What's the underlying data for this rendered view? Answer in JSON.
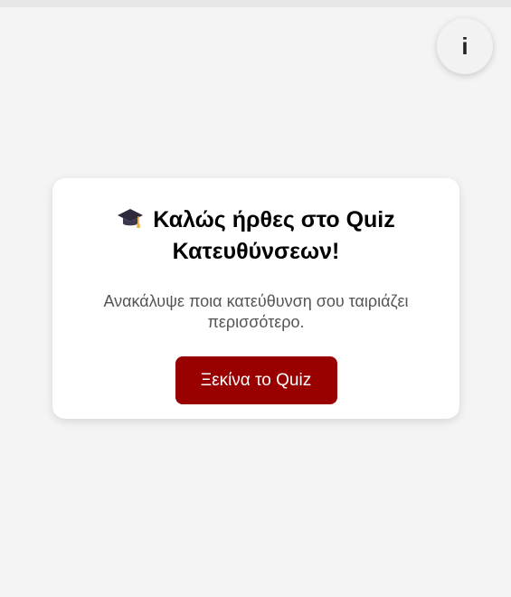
{
  "info_button": {
    "label": "i"
  },
  "welcome_card": {
    "title": "Καλώς ήρθες στο Quiz Κατευθύνσεων!",
    "title_icon": "graduation-cap-icon",
    "subtitle": "Ανακάλυψε ποια κατεύθυνση σου ταιριάζει περισσότερο.",
    "start_button_label": "Ξεκίνα το Quiz"
  },
  "colors": {
    "accent": "#990000",
    "background": "#f4f4f4",
    "card": "#ffffff"
  }
}
